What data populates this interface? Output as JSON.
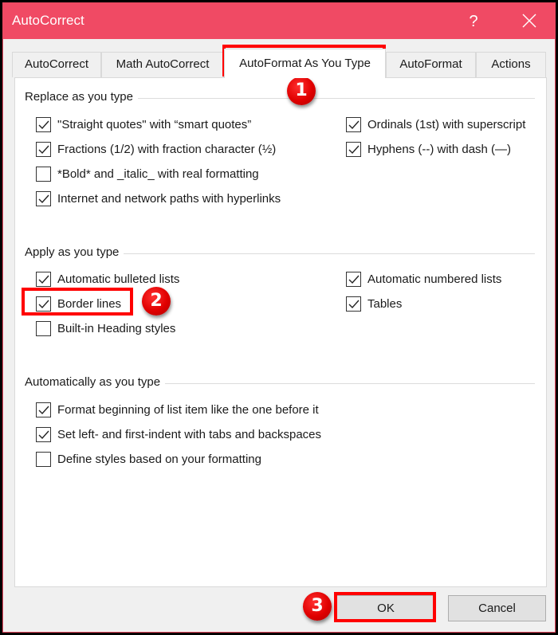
{
  "window": {
    "title": "AutoCorrect",
    "help_label": "?",
    "accent_color": "#f04a64"
  },
  "tabs": [
    {
      "label": "AutoCorrect",
      "active": false
    },
    {
      "label": "Math AutoCorrect",
      "active": false
    },
    {
      "label": "AutoFormat As You Type",
      "active": true
    },
    {
      "label": "AutoFormat",
      "active": false
    },
    {
      "label": "Actions",
      "active": false
    }
  ],
  "groups": {
    "replace": {
      "label": "Replace as you type",
      "options": [
        {
          "label": "\"Straight quotes\" with “smart quotes”",
          "checked": true
        },
        {
          "label": "Fractions (1/2) with fraction character (½)",
          "checked": true
        },
        {
          "label": "*Bold* and _italic_ with real formatting",
          "checked": false
        },
        {
          "label": "Internet and network paths with hyperlinks",
          "checked": true
        },
        {
          "label": "Ordinals (1st) with superscript",
          "checked": true
        },
        {
          "label": "Hyphens (--) with dash (—)",
          "checked": true
        }
      ]
    },
    "apply": {
      "label": "Apply as you type",
      "options": [
        {
          "label": "Automatic bulleted lists",
          "checked": true
        },
        {
          "label": "Border lines",
          "checked": true
        },
        {
          "label": "Built-in Heading styles",
          "checked": false
        },
        {
          "label": "Automatic numbered lists",
          "checked": true
        },
        {
          "label": "Tables",
          "checked": true
        }
      ]
    },
    "auto": {
      "label": "Automatically as you type",
      "options": [
        {
          "label": "Format beginning of list item like the one before it",
          "checked": true
        },
        {
          "label": "Set left- and first-indent with tabs and backspaces",
          "checked": true
        },
        {
          "label": "Define styles based on your formatting",
          "checked": false
        }
      ]
    }
  },
  "buttons": {
    "ok": "OK",
    "cancel": "Cancel"
  },
  "annotations": {
    "color": "#ff0000",
    "steps": [
      "1",
      "2",
      "3"
    ]
  }
}
